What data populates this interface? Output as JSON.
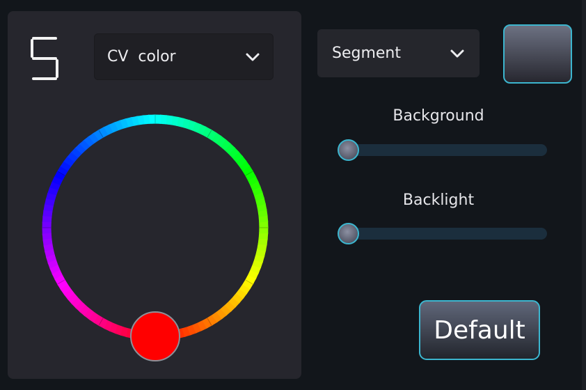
{
  "display": {
    "digit": "5"
  },
  "color_source": {
    "selected": "CV  color"
  },
  "mode": {
    "selected": "Segment"
  },
  "color_wheel": {
    "selected_hue_deg": 0,
    "selected_color": "#ff0000"
  },
  "swatch": {
    "color_top": "#6c7182",
    "color_bottom": "#27272f"
  },
  "sliders": [
    {
      "label": "Background",
      "value": 0
    },
    {
      "label": "Backlight",
      "value": 0
    }
  ],
  "default_button": {
    "label": "Default"
  },
  "colors": {
    "accent": "#3cb6cf",
    "panel": "#26262d",
    "background": "#12161b"
  },
  "icons": {
    "dropdown": "chevron-down-icon"
  }
}
